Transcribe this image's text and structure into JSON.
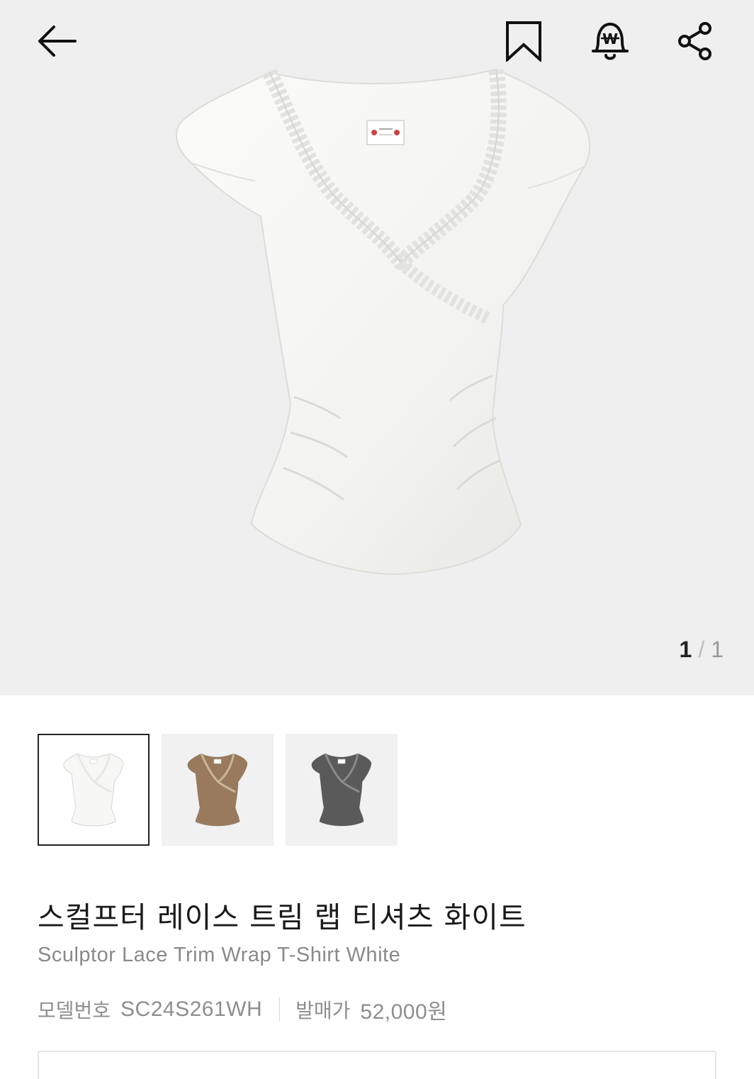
{
  "header": {
    "back_icon": "arrow-left-icon",
    "bookmark_icon": "bookmark-icon",
    "price_alert_icon": "won-bell-icon",
    "share_icon": "share-icon"
  },
  "gallery": {
    "current": "1",
    "separator": "/",
    "total": "1"
  },
  "thumbnails": [
    {
      "color_name": "white",
      "shirt_color": "#f7f7f5",
      "lace_color": "#e8e8e4"
    },
    {
      "color_name": "brown",
      "shirt_color": "#9a7a5c",
      "lace_color": "#c9b59a"
    },
    {
      "color_name": "charcoal",
      "shirt_color": "#5a5a5a",
      "lace_color": "#8a8a8a"
    }
  ],
  "product": {
    "title_ko": "스컬프터 레이스 트림 랩 티셔츠 화이트",
    "title_en": "Sculptor Lace Trim Wrap T-Shirt White",
    "model_label": "모델번호",
    "model_number": "SC24S261WH",
    "price_label": "발매가",
    "price": "52,000원"
  },
  "colors": {
    "hero_bg": "#efefef",
    "text_primary": "#1a1a1a",
    "text_secondary": "#8a8a8a"
  }
}
